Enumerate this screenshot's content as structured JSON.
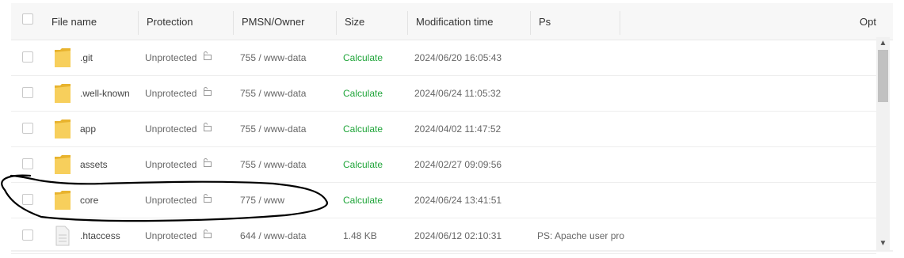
{
  "table": {
    "columns": {
      "filename": "File name",
      "protection": "Protection",
      "pmsn_owner": "PMSN/Owner",
      "size": "Size",
      "modification_time": "Modification time",
      "ps": "Ps",
      "opt": "Opt"
    },
    "rows": [
      {
        "name": ".git",
        "icon": "folder-icon",
        "protection": "Unprotected",
        "pmsn": "755 / www-data",
        "size": "Calculate",
        "mtime": "2024/06/20 16:05:43",
        "ps": ""
      },
      {
        "name": ".well-known",
        "icon": "folder-icon",
        "protection": "Unprotected",
        "pmsn": "755 / www-data",
        "size": "Calculate",
        "mtime": "2024/06/24 11:05:32",
        "ps": ""
      },
      {
        "name": "app",
        "icon": "folder-icon",
        "protection": "Unprotected",
        "pmsn": "755 / www-data",
        "size": "Calculate",
        "mtime": "2024/04/02 11:47:52",
        "ps": ""
      },
      {
        "name": "assets",
        "icon": "folder-icon",
        "protection": "Unprotected",
        "pmsn": "755 / www-data",
        "size": "Calculate",
        "mtime": "2024/02/27 09:09:56",
        "ps": ""
      },
      {
        "name": "core",
        "icon": "folder-icon",
        "protection": "Unprotected",
        "pmsn": "775 / www",
        "size": "Calculate",
        "mtime": "2024/06/24 13:41:51",
        "ps": ""
      },
      {
        "name": ".htaccess",
        "icon": "file-icon",
        "protection": "Unprotected",
        "pmsn": "644 / www-data",
        "size": "1.48 KB",
        "mtime": "2024/06/12 02:10:31",
        "ps": "PS: Apache user pro"
      }
    ]
  },
  "colors": {
    "calculate_link": "#20a53a",
    "folder": "#f5c542",
    "header_bg": "#f7f7f7",
    "annotation_stroke": "#000000"
  },
  "scrollbar": {
    "up": "▲",
    "down": "▼"
  }
}
